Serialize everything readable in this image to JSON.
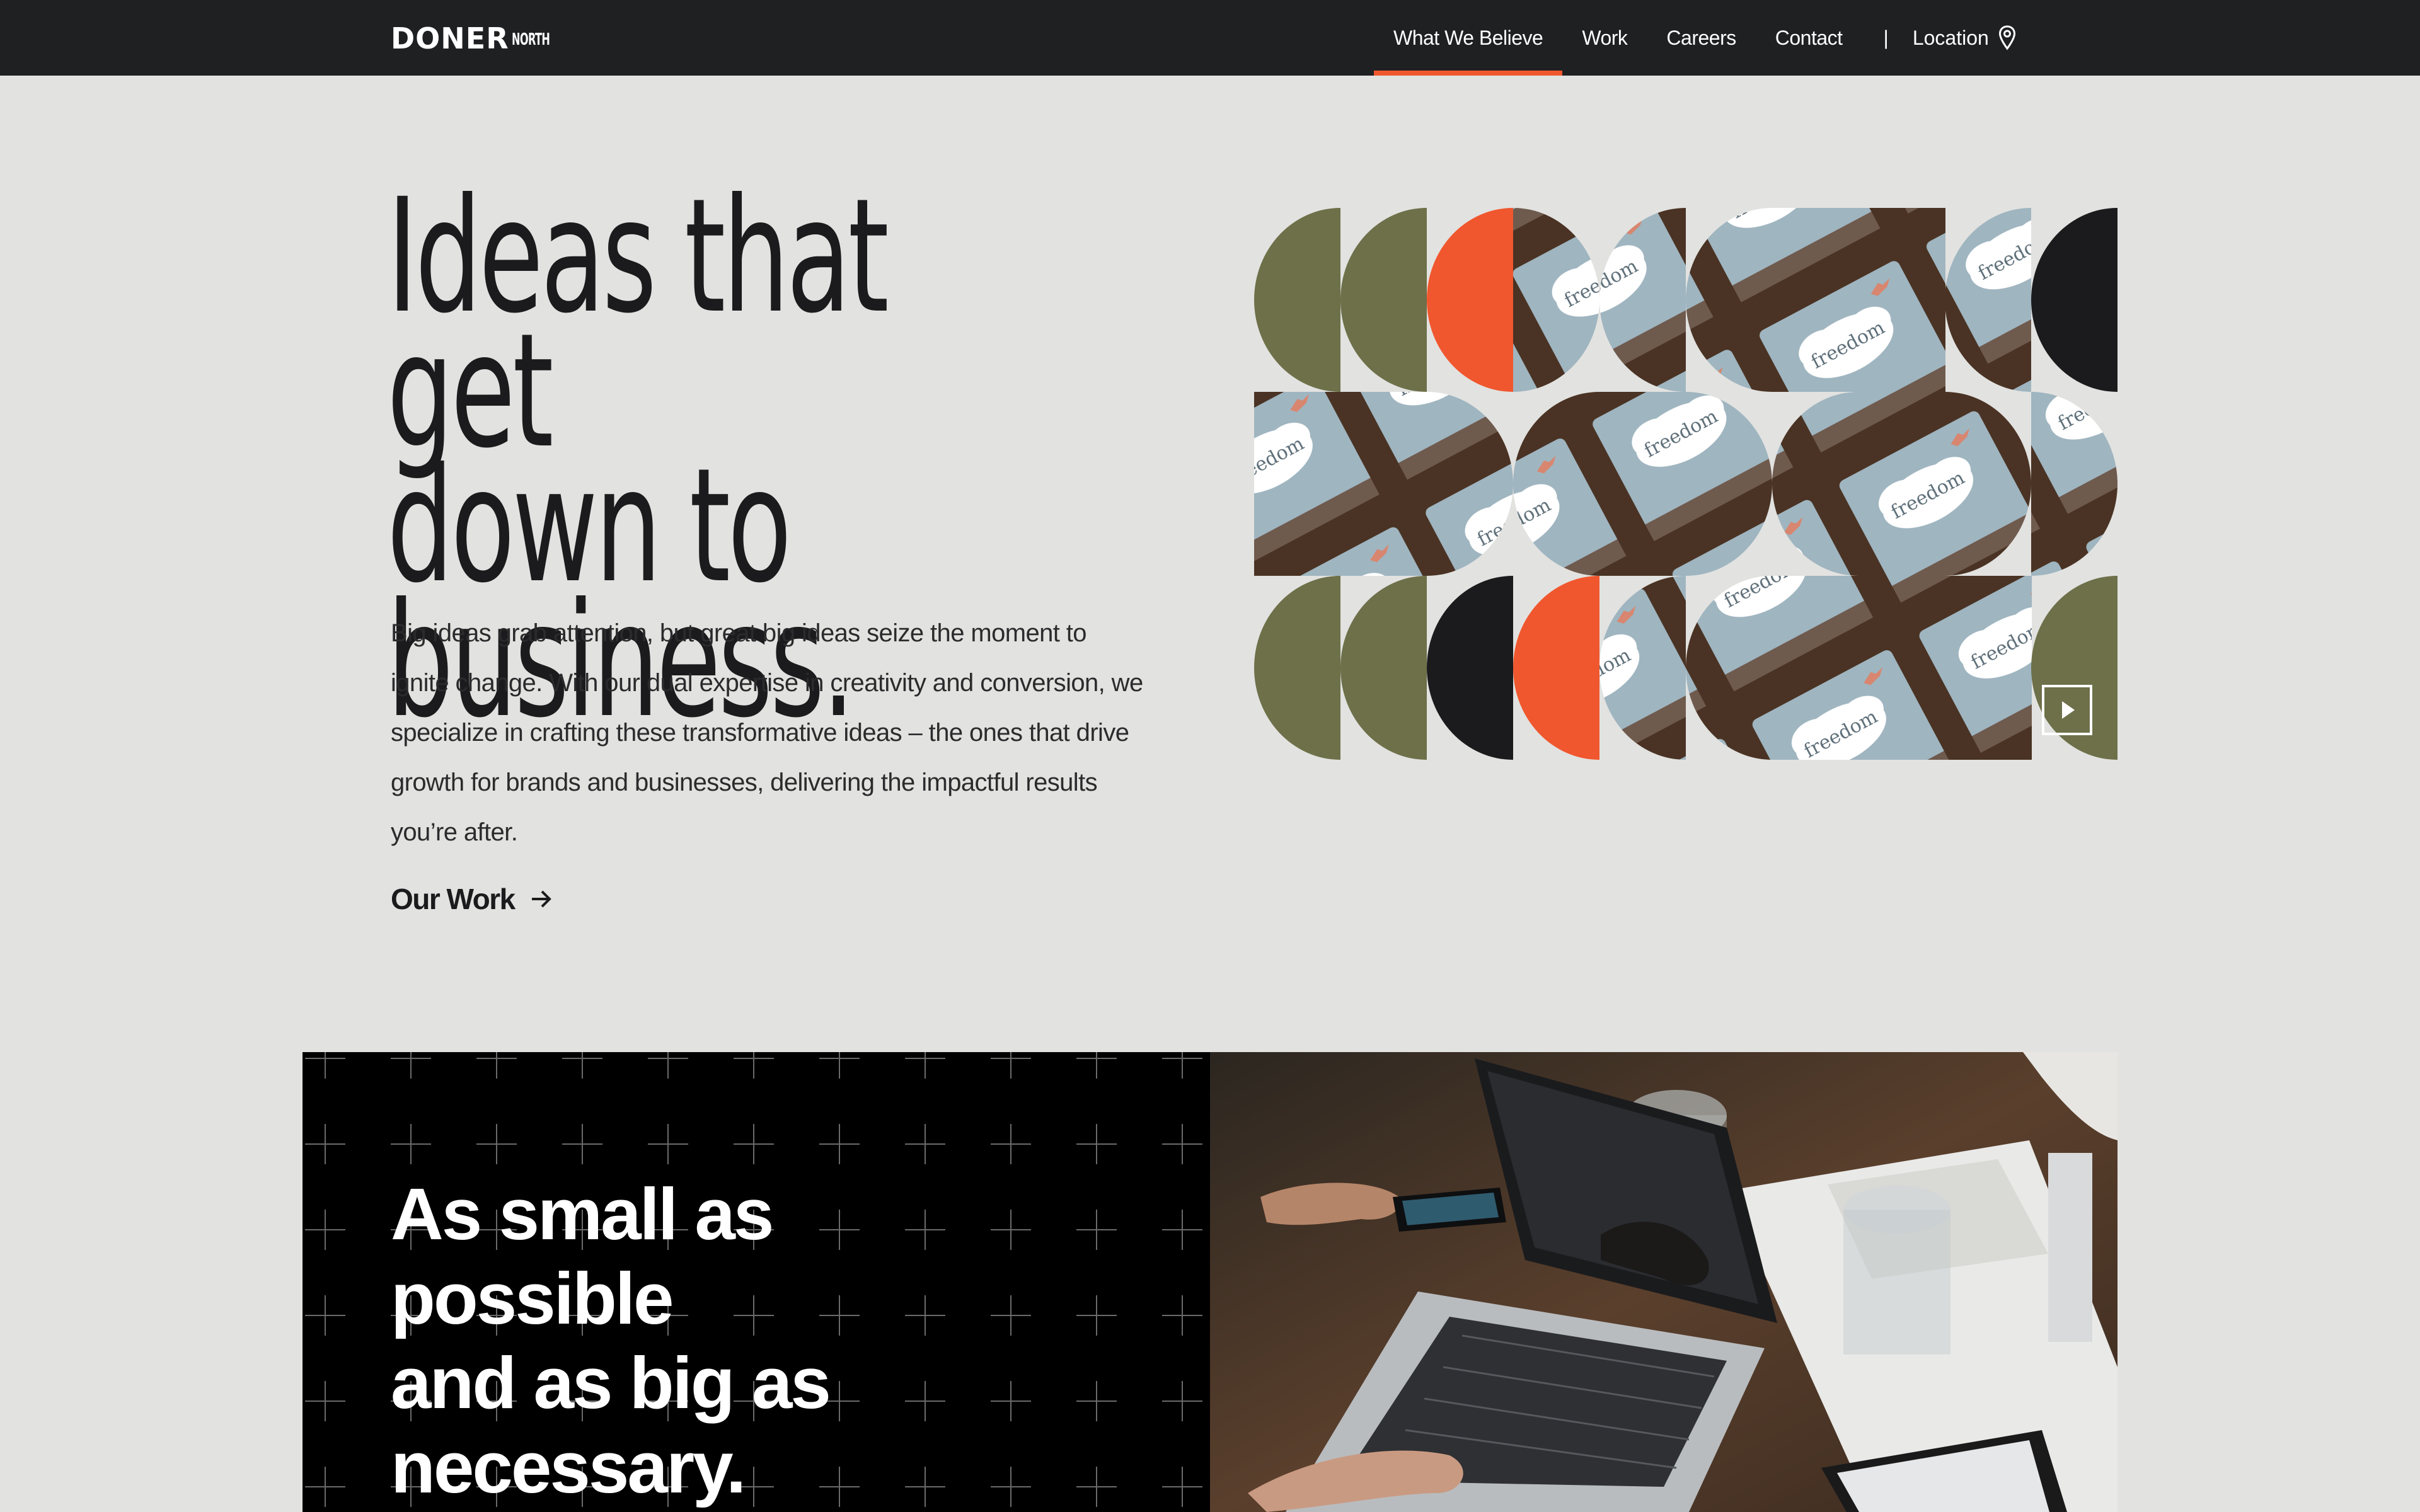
{
  "brand": {
    "name": "DONER",
    "sub": "NORTH",
    "accent": "#f0572e",
    "olive": "#6d7049",
    "dark": "#1b1b1d",
    "box_blue": "#9fb5c0"
  },
  "nav": {
    "items": [
      {
        "label": "What We Believe",
        "active": true
      },
      {
        "label": "Work",
        "active": false
      },
      {
        "label": "Careers",
        "active": false
      },
      {
        "label": "Contact",
        "active": false
      }
    ],
    "separator": "|",
    "location_label": "Location",
    "location_icon": "map-pin-icon"
  },
  "hero": {
    "title_lines": [
      "Ideas that get",
      "down to",
      "business."
    ],
    "body": "Big ideas grab attention, but great big ideas seize the moment to ignite change. With our dual expertise in creativity and conversion, we specialize in crafting these transformative ideas – the ones that drive growth for brands and businesses, delivering the impactful results you’re after.",
    "cta_label": "Our Work",
    "cta_icon": "arrow-right-icon"
  },
  "mosaic": {
    "product_text": "freedom",
    "play_icon": "play-icon"
  },
  "section2": {
    "heading_lines": [
      "As small as",
      "possible",
      "and as big as",
      "necessary."
    ]
  }
}
